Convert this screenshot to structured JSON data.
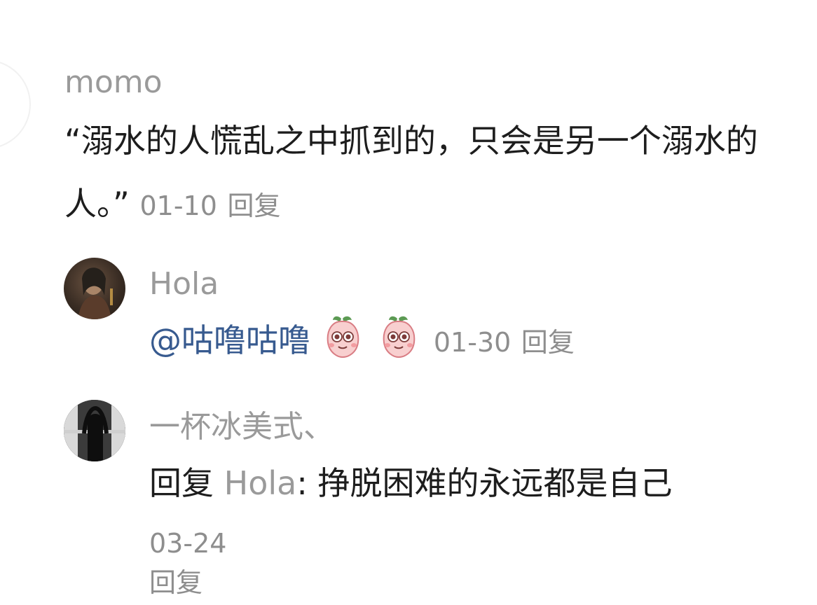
{
  "comments": [
    {
      "username": "momo",
      "text": "“溺水的人慌乱之中抓到的，只会是另一个溺水的人。”",
      "date": "01-10",
      "reply_label": "回复"
    },
    {
      "username": "Hola",
      "mention": "@咕噜咕噜",
      "emojis": [
        "blushing-peach-emoji",
        "blushing-peach-emoji"
      ],
      "date": "01-30",
      "reply_label": "回复"
    },
    {
      "username": "一杯冰美式、",
      "reply_prefix": "回复",
      "reply_to": "Hola",
      "separator": ":",
      "text": "挣脱困难的永远都是自己",
      "date": "03-24",
      "reply_label": "回复"
    }
  ],
  "colors": {
    "username": "#9a9a9a",
    "body_text": "#1d1d1d",
    "meta": "#8e8e8e",
    "mention": "#375a8f",
    "avatar_accent": "#f2a347"
  },
  "icons": {
    "first_avatar": "orange-triangle-avatar",
    "second_avatar": "portrait-avatar",
    "third_avatar": "dark-silhouette-avatar"
  }
}
